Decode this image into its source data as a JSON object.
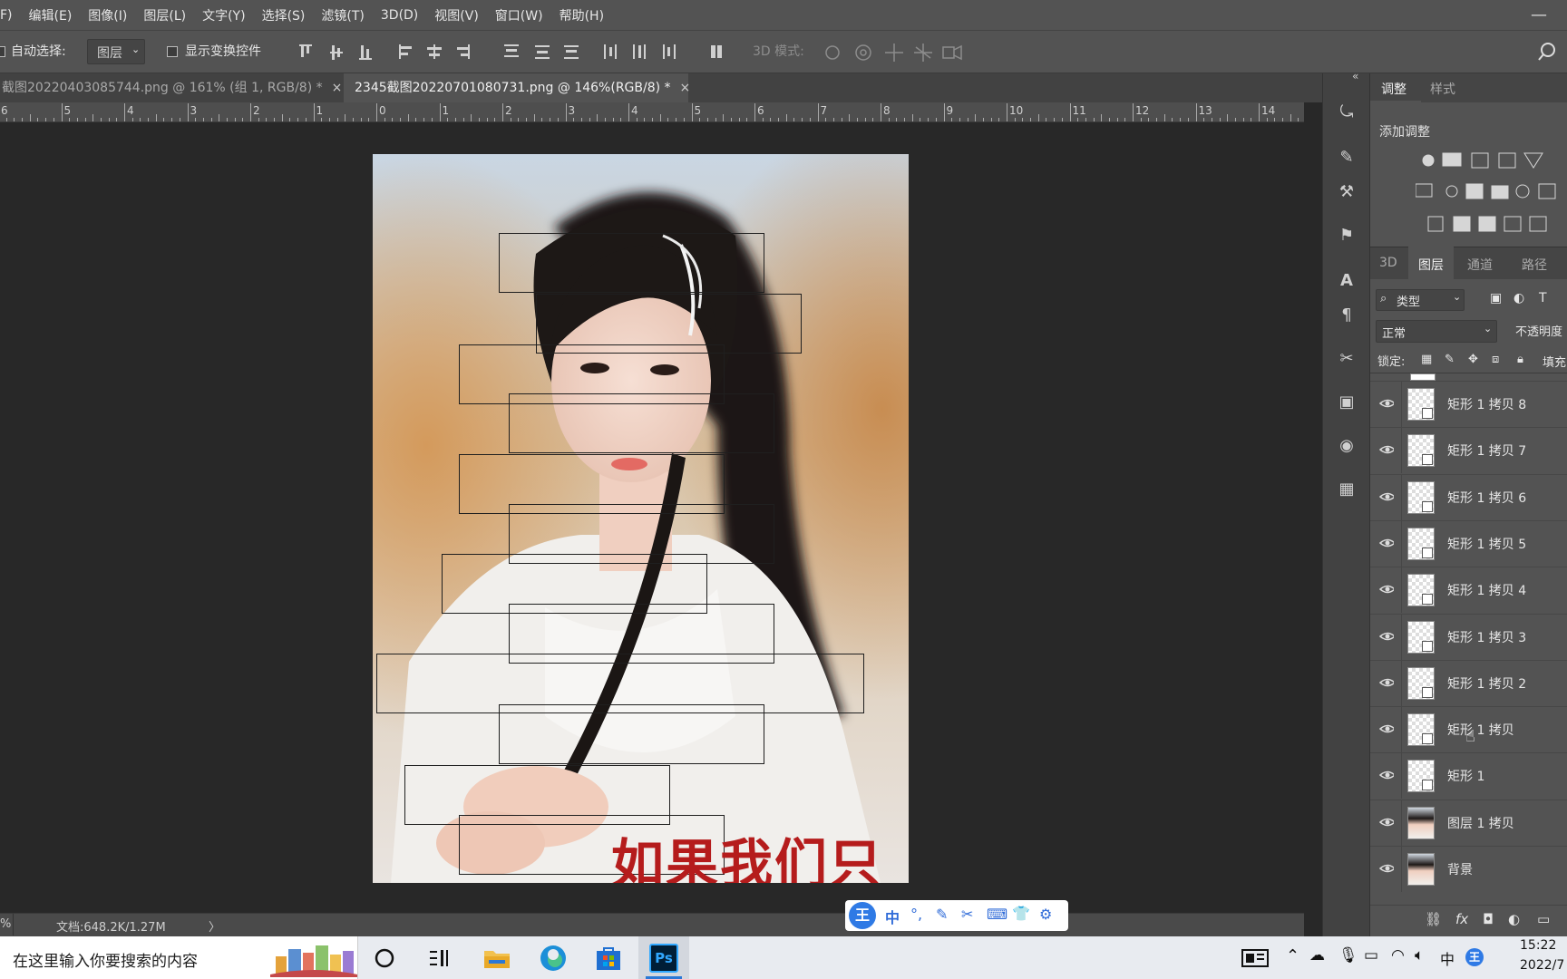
{
  "menu": {
    "items": [
      "F)",
      "编辑(E)",
      "图像(I)",
      "图层(L)",
      "文字(Y)",
      "选择(S)",
      "滤镜(T)",
      "3D(D)",
      "视图(V)",
      "窗口(W)",
      "帮助(H)"
    ]
  },
  "options": {
    "auto_select_label": "自动选择:",
    "auto_select_value": "图层",
    "show_transform_label": "显示变换控件",
    "mode_3d_label": "3D 模式:"
  },
  "tabs": [
    {
      "label": "截图20220403085744.png @ 161% (组 1, RGB/8) *",
      "close": "×"
    },
    {
      "label": "2345截图20220701080731.png @ 146%(RGB/8) *",
      "close": "×"
    }
  ],
  "ruler": {
    "labels": [
      "6",
      "5",
      "4",
      "3",
      "2",
      "1",
      "0",
      "1",
      "2",
      "3",
      "4",
      "5",
      "6",
      "7",
      "8",
      "9",
      "10",
      "11",
      "12",
      "13",
      "14"
    ]
  },
  "canvas": {
    "overlay_text": "如果我们只"
  },
  "status": {
    "zoom": "%",
    "doc": "文档:648.2K/1.27M",
    "arrow": "〉"
  },
  "panel": {
    "adjust_tab": "调整",
    "style_tab": "样式",
    "add_adjust": "添加调整",
    "tabs": [
      "3D",
      "图层",
      "通道",
      "路径"
    ],
    "filter_type": "类型",
    "blend_mode": "正常",
    "opacity_label": "不透明度",
    "lock_label": "锁定:",
    "fill_label": "填充",
    "layers": [
      {
        "name": "矩形 1 拷贝 8",
        "thumb": "transparent"
      },
      {
        "name": "矩形 1 拷贝 7",
        "thumb": "transparent"
      },
      {
        "name": "矩形 1 拷贝 6",
        "thumb": "transparent"
      },
      {
        "name": "矩形 1 拷贝 5",
        "thumb": "transparent"
      },
      {
        "name": "矩形 1 拷贝 4",
        "thumb": "transparent"
      },
      {
        "name": "矩形 1 拷贝 3",
        "thumb": "transparent"
      },
      {
        "name": "矩形 1 拷贝 2",
        "thumb": "transparent"
      },
      {
        "name": "矩形 1 拷贝",
        "thumb": "transparent"
      },
      {
        "name": "矩形 1",
        "thumb": "transparent"
      },
      {
        "name": "图层 1 拷贝",
        "thumb": "photo"
      },
      {
        "name": "背景",
        "thumb": "photo"
      }
    ]
  },
  "ime": {
    "items": [
      "王",
      "中",
      "°,",
      "✎",
      "✂",
      "⌨",
      "👕",
      "⚙"
    ]
  },
  "taskbar": {
    "search_placeholder": "在这里输入你要搜索的内容",
    "time": "15:22",
    "date": "2022/7",
    "ime_indicator": "中"
  },
  "colors": {
    "accent_text": "#b51c1c",
    "ps_blue": "#31a8ff",
    "ps_dark": "#001e36"
  }
}
